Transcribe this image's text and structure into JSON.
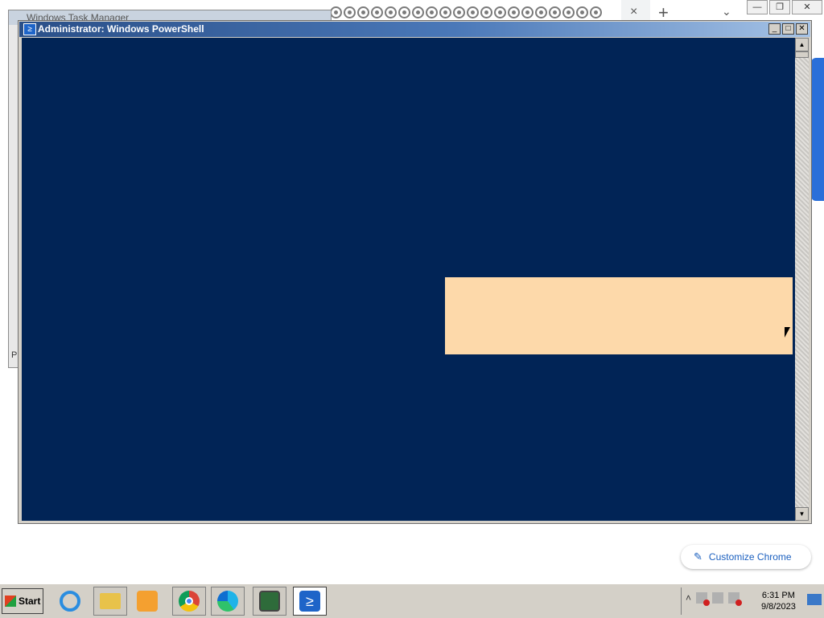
{
  "browser": {
    "new_tab_label": "+",
    "tab_close_label": "×",
    "tab_search_label": "⌄",
    "window_controls": [
      "—",
      "❐",
      "✕"
    ],
    "customize_label": "Customize Chrome"
  },
  "taskmgr": {
    "title": "Windows Task Manager",
    "partial_label": "P"
  },
  "powershell": {
    "title": "Administrator: Windows PowerShell",
    "icon_glyph": "≥",
    "controls": [
      "_",
      "□",
      "✕"
    ],
    "scroll_up": "▲",
    "scroll_down": "▼"
  },
  "taskbar": {
    "start_label": "Start",
    "icons": [
      "internet-explorer-icon",
      "file-explorer-icon",
      "media-player-icon",
      "chrome-icon",
      "edge-icon",
      "server-manager-icon",
      "powershell-icon"
    ],
    "tray_chevron": "˄",
    "clock_time": "6:31 PM",
    "clock_date": "9/8/2023"
  },
  "colors": {
    "console_bg": "#012456",
    "selection": "#fdd9aa",
    "title_gradient_start": "#2a4f88",
    "link_blue": "#1a5fbf"
  }
}
